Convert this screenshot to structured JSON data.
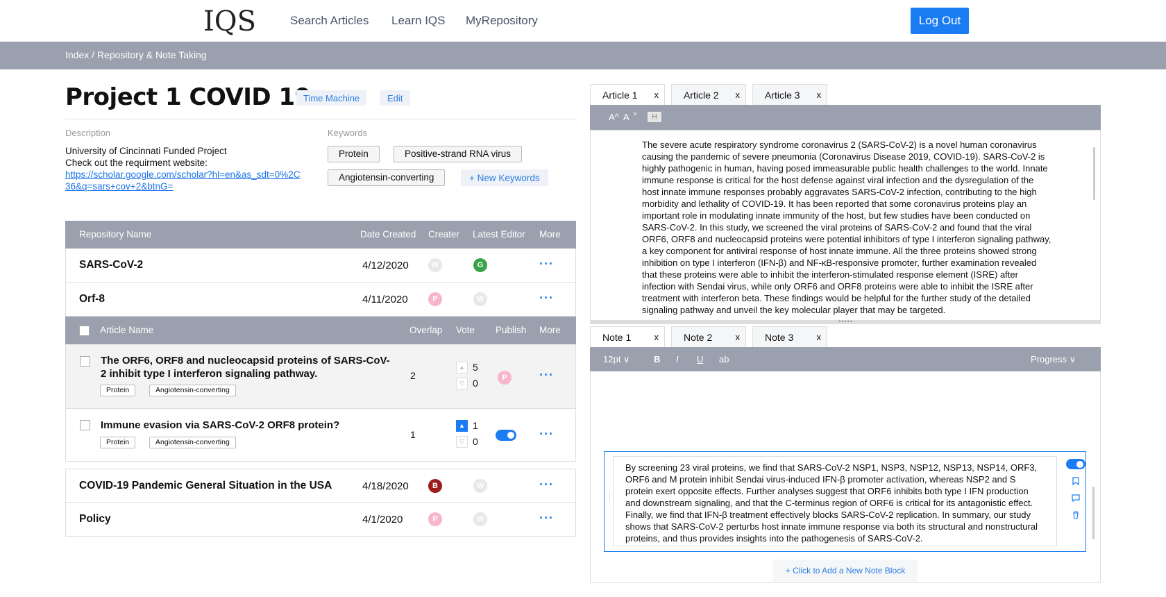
{
  "header": {
    "logo_text": "IQS",
    "nav": [
      "Search Articles",
      "Learn IQS",
      "MyRepository"
    ],
    "logout_label": "Log Out"
  },
  "breadcrumb": "Index / Repository & Note Taking",
  "project": {
    "title": "Project 1 COVID 19",
    "time_machine_label": "Time Machine",
    "edit_label": "Edit",
    "description_label": "Description",
    "description_line1": "University of Cincinnati Funded Project",
    "description_line2": "Check out the requirment website:",
    "description_link": "https://scholar.google.com/scholar?hl=en&as_sdt=0%2C36&q=sars+cov+2&btnG=",
    "keywords_label": "Keywords",
    "keywords": [
      "Protein",
      "Positive-strand RNA virus",
      "Angiotensin-converting"
    ],
    "new_keywords_label": "+ New Keywords"
  },
  "repo_table": {
    "headers": [
      "Repository Name",
      "Date Created",
      "Creater",
      "Latest Editor",
      "More"
    ],
    "rows": [
      {
        "name": "SARS-CoV-2",
        "date": "4/12/2020",
        "creator": "W",
        "editor": "G"
      },
      {
        "name": "Orf-8",
        "date": "4/11/2020",
        "creator": "P",
        "editor": "W"
      },
      {
        "name": "COVID-19 Pandemic General Situation in the USA",
        "date": "4/18/2020",
        "creator": "B",
        "editor": "W"
      },
      {
        "name": "Policy",
        "date": "4/1/2020",
        "creator": "P",
        "editor": "W"
      }
    ],
    "more_symbol": "···"
  },
  "article_table": {
    "headers": [
      "Article Name",
      "Overlap",
      "Vote",
      "Publish",
      "More"
    ],
    "rows": [
      {
        "title": "The ORF6, ORF8 and nucleocapsid proteins of SARS-CoV-2 inhibit type I interferon signaling pathway.",
        "tags": [
          "Protein",
          "Angiotensin-converting"
        ],
        "overlap": "2",
        "up": "5",
        "down": "0",
        "publisher": "P"
      },
      {
        "title": "Immune evasion via SARS-CoV-2 ORF8 protein?",
        "tags": [
          "Protein",
          "Angiotensin-converting"
        ],
        "overlap": "1",
        "up": "1",
        "down": "0",
        "published": true
      }
    ]
  },
  "article_tabs": [
    "Article 1",
    "Article 2",
    "Article 3"
  ],
  "note_tabs": [
    "Note 1",
    "Note 2",
    "Note 3"
  ],
  "tab_close": "x",
  "article_toolbar": {
    "font_up": "A^",
    "font_down": "A",
    "down_caret": "˅",
    "highlight": "H"
  },
  "article_text": "The severe acute respiratory syndrome coronavirus 2 (SARS-CoV-2) is a novel human coronavirus causing the pandemic of severe pneumonia (Coronavirus Disease 2019, COVID-19). SARS-CoV-2 is highly pathogenic in human, having posed immeasurable public health challenges to the world. Innate immune response is critical for the host defense against viral infection and the dysregulation of the host innate immune responses probably aggravates SARS-CoV-2 infection, contributing to the high morbidity and lethality of COVID-19. It has been reported that some coronavirus proteins play an important role in modulating innate immunity of the host, but few studies have been conducted on SARS-CoV-2. In this study, we screened the viral proteins of SARS-CoV-2 and found that the viral ORF6, ORF8 and nucleocapsid proteins were potential inhibitors of type I interferon signaling pathway, a key component for antiviral response of host innate immune. All the three proteins showed strong inhibition on type I interferon (IFN-β) and NF-κB-responsive promoter, further examination revealed that these proteins were able to inhibit the interferon-stimulated response element (ISRE) after infection with Sendai virus, while only ORF6 and ORF8 proteins were able to inhibit the ISRE after treatment with interferon beta. These findings would be helpful for the further study of the detailed signaling pathway and unveil the key molecular player that may be targeted.",
  "note_toolbar": {
    "font_size": "12pt ∨",
    "bold": "B",
    "italic": "I",
    "underline": "U",
    "strike": "ab",
    "progress": "Progress ∨"
  },
  "note_text": "By screening 23 viral proteins, we find that SARS-CoV-2 NSP1, NSP3, NSP12, NSP13, NSP14, ORF3, ORF6 and M protein inhibit Sendai virus-induced IFN-β promoter activation, whereas NSP2 and S protein exert opposite effects. Further analyses suggest that ORF6 inhibits both type I IFN production and downstream signaling, and that the C-terminus region of ORF6 is critical for its antagonistic effect. Finally, we find that IFN-β treatment effectively blocks SARS-CoV-2 replication. In summary, our study shows that SARS-CoV-2 perturbs host innate immune response via both its structural and nonstructural proteins, and thus provides insights into the pathogenesis of SARS-CoV-2.",
  "add_note_label": "+ Click to Add a New Note Block",
  "colors": {
    "accent": "#1a7cf2",
    "header_gray": "#9aa0ad",
    "avatar_w": "#e8e8e8",
    "avatar_g": "#3aa34a",
    "avatar_p": "#f7b6cc",
    "avatar_b": "#9b1c1c"
  }
}
